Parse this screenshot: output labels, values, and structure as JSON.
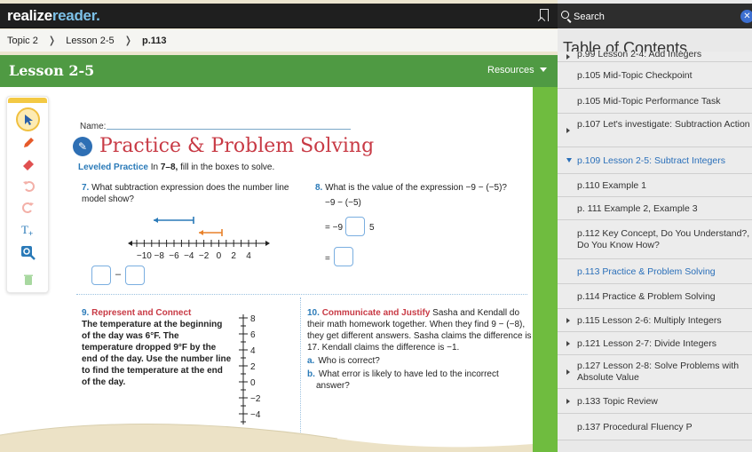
{
  "app": {
    "brand_left": "realize",
    "brand_right": "reader.",
    "brand_color_dark": "#ffffff",
    "brand_color_accent": "#7dc1e8"
  },
  "breadcrumb": {
    "topic": "Topic 2",
    "lesson": "Lesson 2-5",
    "page": "p.113"
  },
  "lesson_header": {
    "title": "Lesson 2-5",
    "resources_label": "Resources",
    "bar_color": "#4f9a43"
  },
  "worksheet": {
    "name_label": "Name:",
    "title": "Practice & Problem Solving",
    "leveled_practice_label": "Leveled Practice",
    "leveled_instruction_a": "In",
    "leveled_instruction_range": "7–8,",
    "leveled_instruction_b": "fill in the boxes to solve.",
    "q7": {
      "num": "7.",
      "text": "What subtraction expression does the number line model show?",
      "ticks": [
        "−10",
        "−8",
        "−6",
        "−4",
        "−2",
        "0",
        "2",
        "4"
      ],
      "minus": "–"
    },
    "q8": {
      "num": "8.",
      "text": "What is the value of the expression −9 − (−5)?",
      "line1": "−9 − (−5)",
      "line2_prefix": "= −9",
      "line2_suffix": "5",
      "line3_prefix": "="
    },
    "q9": {
      "num": "9.",
      "headline": "Represent and Connect",
      "text": "The temperature at the beginning of the day was 6°F. The temperature dropped 9°F by the end of the day. Use the number line to find the temperature at the end of the day.",
      "ticks": [
        "8",
        "6",
        "4",
        "2",
        "0",
        "−2",
        "−4"
      ]
    },
    "q10": {
      "num": "10.",
      "headline": "Communicate and Justify",
      "text": "Sasha and Kendall do their math homework together. When they find 9 − (−8), they get different answers. Sasha claims the difference is 17. Kendall claims the difference is −1.",
      "a_label": "a.",
      "a_text": "Who is correct?",
      "b_label": "b.",
      "b_text": "What error is likely to have led to the incorrect answer?"
    }
  },
  "toc": {
    "search_placeholder": "Search",
    "title": "Table of Contents",
    "items": [
      {
        "label": "p.99 Lesson 2-4: Add Integers",
        "arrow": "right"
      },
      {
        "label": "p.105 Mid-Topic Checkpoint",
        "arrow": "none"
      },
      {
        "label": "p.105 Mid-Topic Performance Task",
        "arrow": "none"
      },
      {
        "label": "p.107 Let's investigate: Subtraction Action",
        "arrow": "right"
      },
      {
        "label": "p.109 Lesson 2-5: Subtract Integers",
        "arrow": "down"
      },
      {
        "label": "p.110 Example 1",
        "arrow": "none"
      },
      {
        "label": "p. 111 Example 2, Example 3",
        "arrow": "none"
      },
      {
        "label": "p.112 Key Concept, Do You Understand?, Do You Know How?",
        "arrow": "none"
      },
      {
        "label": "p.113 Practice & Problem Solving",
        "arrow": "none"
      },
      {
        "label": "p.114 Practice & Problem Solving",
        "arrow": "none"
      },
      {
        "label": "p.115 Lesson 2-6: Multiply Integers",
        "arrow": "right"
      },
      {
        "label": "p.121 Lesson 2-7: Divide Integers",
        "arrow": "right"
      },
      {
        "label": "p.127 Lesson 2-8: Solve Problems with Absolute Value",
        "arrow": "right"
      },
      {
        "label": "p.133 Topic Review",
        "arrow": "right"
      },
      {
        "label": "p.137 Procedural Fluency P",
        "arrow": "none"
      }
    ],
    "accent": "#2a6fb9"
  }
}
